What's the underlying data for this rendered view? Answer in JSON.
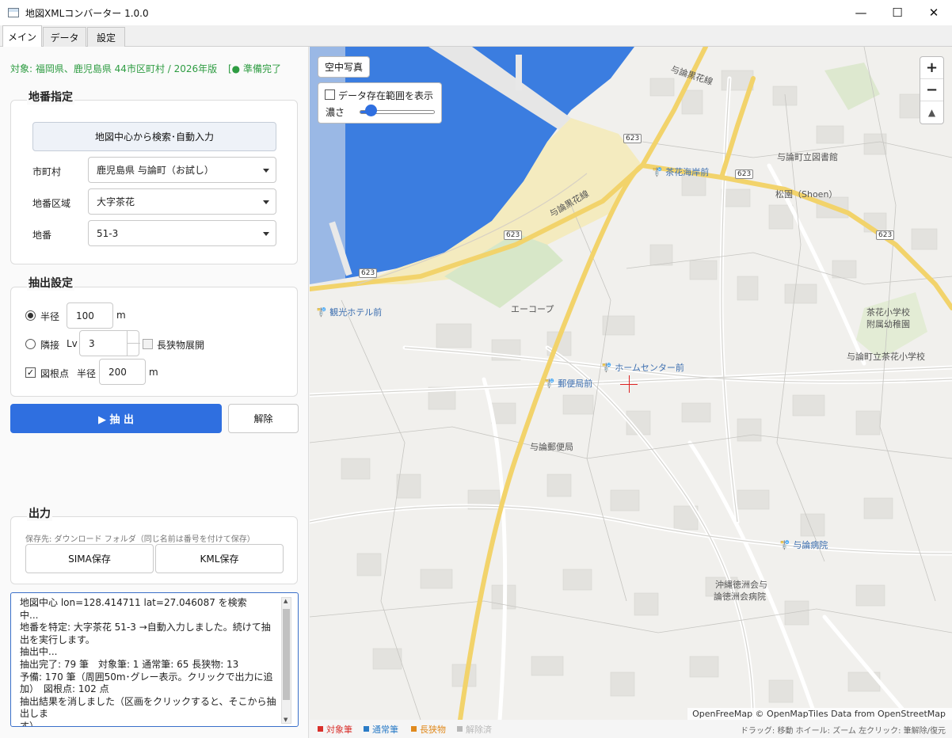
{
  "window": {
    "title": "地図XMLコンバーター 1.0.0",
    "minimize": "—",
    "maximize": "☐",
    "close": "✕"
  },
  "tabs": [
    {
      "label": "メイン",
      "active": true
    },
    {
      "label": "データ",
      "active": false
    },
    {
      "label": "設定",
      "active": false
    }
  ],
  "target": {
    "text": "対象: 福岡県、鹿児島県 44市区町村 / 2026年版",
    "status": "[● 準備完了"
  },
  "parcel": {
    "section_title": "地番指定",
    "autofill_button": "地図中心から検索･自動入力",
    "municipality_label": "市町村",
    "municipality_value": "鹿児島県 与論町（お試し）",
    "district_label": "地番区域",
    "district_value": "大字茶花",
    "lot_label": "地番",
    "lot_value": "51-3"
  },
  "extract": {
    "section_title": "抽出設定",
    "radius_label": "半径",
    "radius_value": "100",
    "radius_unit": "m",
    "adjacent_label": "隣接",
    "lv_label": "Lv",
    "lv_value": "3",
    "long_narrow_label": "長狭物展開",
    "benchmark_label": "図根点",
    "benchmark_radius_label": "半径",
    "benchmark_radius_value": "200",
    "benchmark_radius_unit": "m",
    "radius_selected": true,
    "benchmark_checked": true,
    "long_narrow_checked": false
  },
  "actions": {
    "extract_button": "▶ 抽 出",
    "clear_button": "解除"
  },
  "output": {
    "section_title": "出力",
    "save_note": "保存先: ダウンロード フォルダ（同じ名前は番号を付けて保存）",
    "sima_button": "SIMA保存",
    "kml_button": "KML保存"
  },
  "log": [
    "地図中心 lon=128.414711 lat=27.046087 を検索",
    "中...",
    "地番を特定: 大字茶花 51-3 →自動入力しました。続けて抽",
    "出を実行します。",
    "抽出中...",
    "抽出完了: 79 筆　対象筆: 1  通常筆: 65  長狭物: 13",
    "予備: 170 筆（周囲50m･グレー表示。クリックで出力に追",
    "加）　図根点: 102 点",
    "抽出結果を消しました（区画をクリックすると、そこから抽出しま",
    "す）。"
  ],
  "map": {
    "aerial_button": "空中写真",
    "show_range_label": "データ存在範囲を表示",
    "density_label": "濃さ",
    "density_level": 0.15,
    "zoom_in": "+",
    "zoom_out": "−",
    "compass": "▲",
    "attribution": "OpenFreeMap © OpenMapTiles Data from OpenStreetMap",
    "labels": {
      "road_name_1": "与論黒花線",
      "road_name_2": "与論黒花線",
      "shield_1": "623",
      "shield_2": "623",
      "shield_3": "623",
      "shield_4": "623",
      "shield_5": "623",
      "library": "与論町立図書館",
      "chabana_bus": "茶花海岸前",
      "matsuzono": "松園（Shoen）",
      "kanko_hotel": "観光ホテル前",
      "a_coop": "エーコープ",
      "home_center": "ホームセンター前",
      "post_office_bus": "郵便局前",
      "post_office": "与論郵便局",
      "school": "茶花小学校",
      "school_2": "附属幼稚園",
      "school_3": "与論町立茶花小学校",
      "hospital_bus": "与論病院",
      "hospital_1": "沖縄徳洲会与",
      "hospital_2": "論徳洲会病院"
    },
    "colors": {
      "sea": "#3b7de0",
      "beach": "#f4ebbf",
      "road": "#f2d36b",
      "land": "#f1f0ed",
      "block": "#e3e2de",
      "park": "#d7e7c8"
    }
  },
  "legend": [
    {
      "label": "対象筆",
      "color": "#d9302c"
    },
    {
      "label": "通常筆",
      "color": "#2b7cc7"
    },
    {
      "label": "長狭物",
      "color": "#e08a1e"
    },
    {
      "label": "解除済",
      "color": "#b8b8b8"
    }
  ],
  "hint": "ドラッグ: 移動  ホイール: ズーム  左クリック: 筆解除/復元"
}
